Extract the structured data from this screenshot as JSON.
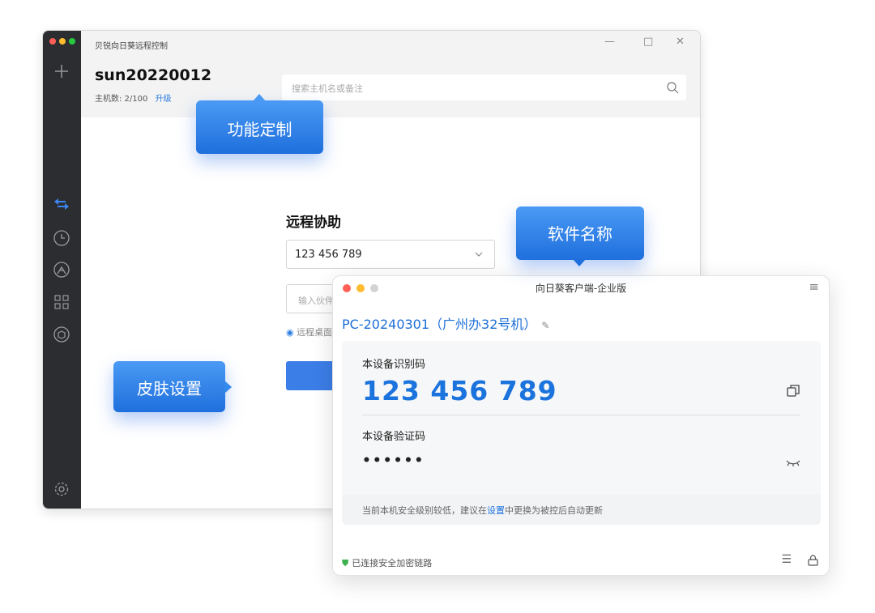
{
  "main_window": {
    "title": "贝锐向日葵远程控制",
    "window_controls": {
      "minimize": "—",
      "maximize": "□",
      "close": "✕"
    },
    "account": "sun20220012",
    "host_count_label": "主机数: 2/100",
    "upgrade_label": "升级",
    "search": {
      "placeholder": "搜索主机名或备注",
      "icon": "search-icon"
    },
    "section_title": "远程协助",
    "partner_id_value": "123 456 789",
    "partner_input_placeholder": "输入伙伴",
    "radio_label": "远程桌面",
    "sidebar_icons": [
      "plus-icon",
      "swap-icon",
      "clock-icon",
      "remote-icon",
      "apps-icon",
      "cube-icon",
      "settings-icon"
    ]
  },
  "client_window": {
    "title": "向日葵客户端-企业版",
    "device_name": "PC-20240301（广州办32号机）",
    "id_label": "本设备识别码",
    "id_value": "123 456 789",
    "password_label": "本设备验证码",
    "password_value": "••••••",
    "warning_prefix": "当前本机安全级别较低，建议在",
    "warning_link": "设置",
    "warning_suffix": "中更换为被控后自动更新",
    "status": "已连接安全加密链路"
  },
  "callouts": {
    "feature": "功能定制",
    "software_name": "软件名称",
    "skin": "皮肤设置"
  },
  "colors": {
    "accent": "#1b73dd",
    "sidebar": "#2b2d31",
    "callout": "#2f84ea",
    "secure": "#3bb24e"
  }
}
